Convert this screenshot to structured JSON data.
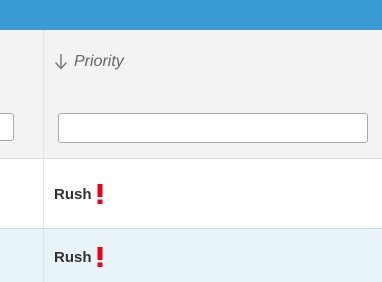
{
  "header": {
    "columns": [
      {
        "label": "Priority",
        "sort_icon": "arrow-down-icon",
        "sort_direction": "descending"
      }
    ]
  },
  "filters": {
    "left_value": "",
    "priority_value": ""
  },
  "rows": [
    {
      "priority": "Rush",
      "icon": "exclamation-icon",
      "selected": false
    },
    {
      "priority": "Rush",
      "icon": "exclamation-icon",
      "selected": true
    }
  ],
  "colors": {
    "top_bar": "#3a9ad3",
    "header_bg": "#f3f3f3",
    "selected_row_bg": "#e9f4f9",
    "rush_icon": "#e8001c"
  }
}
